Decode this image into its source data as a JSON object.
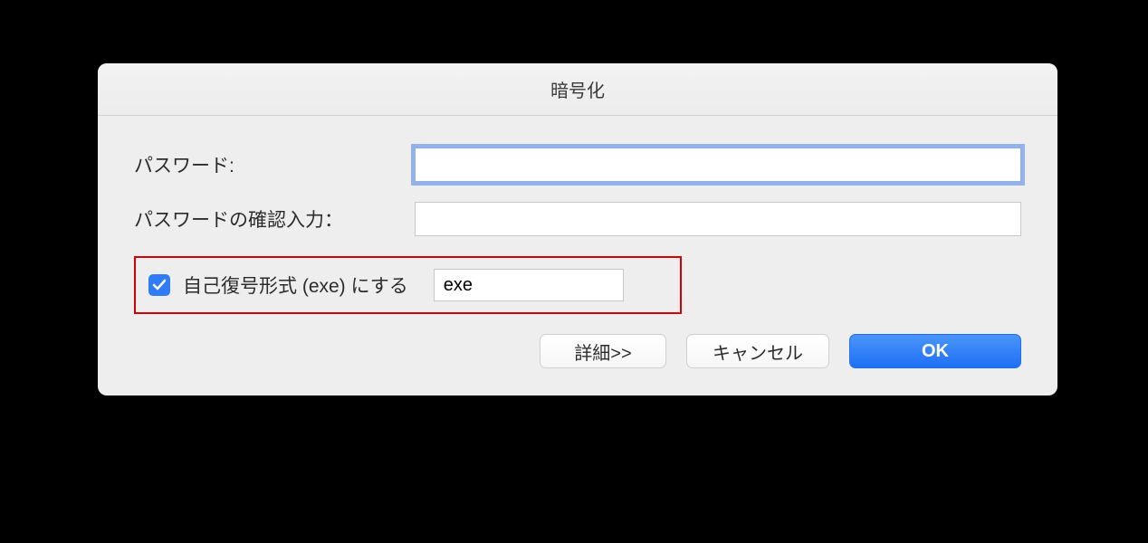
{
  "dialog": {
    "title": "暗号化"
  },
  "form": {
    "password_label": "パスワード:",
    "password_value": "",
    "confirm_label": "パスワードの確認入力：",
    "confirm_value": ""
  },
  "selfextract": {
    "checked": true,
    "label": "自己復号形式 (exe) にする",
    "ext_value": "exe"
  },
  "buttons": {
    "details": "詳細>>",
    "cancel": "キャンセル",
    "ok": "OK"
  }
}
